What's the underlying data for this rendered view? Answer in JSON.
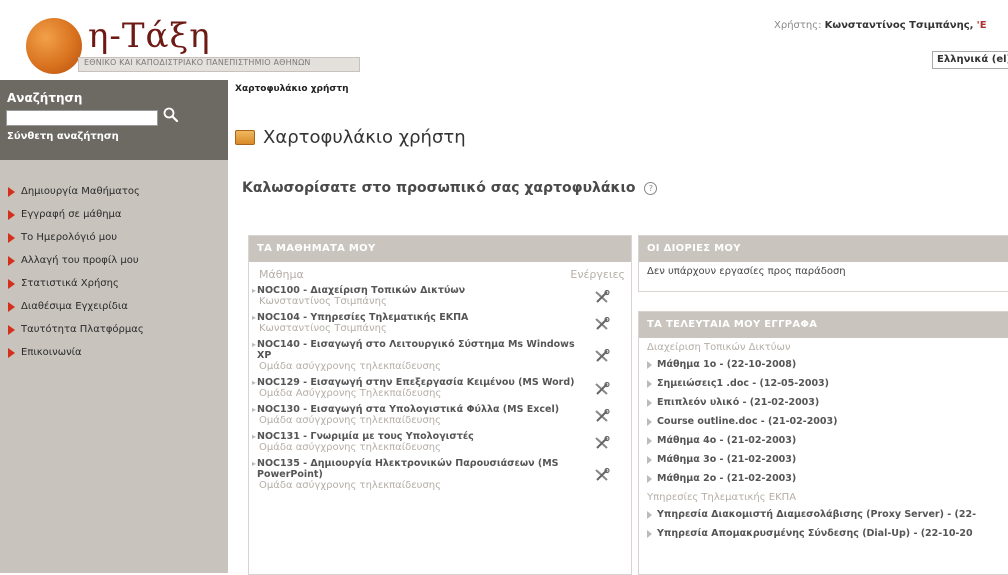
{
  "header": {
    "logo_text": "η-Τάξη",
    "logo_subtitle": "ΕΘΝΙΚΟ ΚΑΙ ΚΑΠΟΔΙΣΤΡΙΑΚΟ ΠΑΝΕΠΙΣΤΗΜΙΟ ΑΘΗΝΩΝ",
    "user_label": "Χρήστης:",
    "user_name": "Κωνσταντίνος Τσιμπάνης,",
    "user_extra": "'Ε",
    "language_selected": "Ελληνικά (el)"
  },
  "sidebar": {
    "search_title": "Αναζήτηση",
    "search_value": "",
    "advanced_search": "Σύνθετη αναζήτηση",
    "menu": [
      {
        "label": "Δημιουργία Μαθήματος"
      },
      {
        "label": "Εγγραφή σε μάθημα"
      },
      {
        "label": "Το Ημερολόγιό μου"
      },
      {
        "label": "Αλλαγή του προφίλ μου"
      },
      {
        "label": "Στατιστικά Χρήσης"
      },
      {
        "label": "Διαθέσιμα Εγχειρίδια"
      },
      {
        "label": "Ταυτότητα Πλατφόρμας"
      },
      {
        "label": "Επικοινωνία"
      }
    ]
  },
  "main": {
    "breadcrumb": "Χαρτοφυλάκιο χρήστη",
    "page_title": "Χαρτοφυλάκιο χρήστη",
    "welcome": "Καλωσορίσατε στο προσωπικό σας χαρτοφυλάκιο",
    "help_glyph": "?"
  },
  "courses": {
    "header": "ΤΑ ΜΑΘΗΜΑΤΑ ΜΟΥ",
    "col_course": "Μάθημα",
    "col_actions": "Ενέργειες",
    "rows": [
      {
        "title": "NOC100 - Διαχείριση Τοπικών Δικτύων",
        "prof": "Κωνσταντίνος Τσιμπάνης"
      },
      {
        "title": "NOC104 - Υπηρεσίες Τηλεματικής ΕΚΠΑ",
        "prof": "Κωνσταντίνος Τσιμπάνης"
      },
      {
        "title": "NOC140 - Εισαγωγή στο Λειτουργικό Σύστημα Ms Windows XP",
        "prof": "Ομάδα ασύγχρονης τηλεκπαίδευσης"
      },
      {
        "title": "NOC129 - Εισαγωγή στην Επεξεργασία Κειμένου (MS Word)",
        "prof": "Ομάδα Ασύγχρονης Τηλεκπαίδευσης"
      },
      {
        "title": "NOC130 - Εισαγωγή στα Υπολογιστικά Φύλλα (MS Excel)",
        "prof": "Ομάδα ασύγχρονης τηλεκπαίδευσης"
      },
      {
        "title": "NOC131 - Γνωριμία με τους Υπολογιστές",
        "prof": "Ομάδα ασύγχρονης τηλεκπαίδευσης"
      },
      {
        "title": "NOC135 - Δημιουργία Ηλεκτρονικών Παρουσιάσεων (MS PowerPoint)",
        "prof": "Ομάδα ασύγχρονης τηλεκπαίδευσης"
      }
    ]
  },
  "deadlines": {
    "header": "ΟΙ ΔΙΟΡΙΕΣ ΜΟΥ",
    "empty_text": "Δεν υπάρχουν εργασίες προς παράδοση"
  },
  "documents": {
    "header": "ΤΑ ΤΕΛΕΥΤΑΙΑ ΜΟΥ ΕΓΓΡΑΦΑ",
    "group1": "Διαχείριση Τοπικών Δικτύων",
    "items1": [
      "Μάθημα 1ο - (22-10-2008)",
      "Σημειώσεις1 .doc - (12-05-2003)",
      "Επιπλεόν υλικό - (21-02-2003)",
      "Course outline.doc - (21-02-2003)",
      "Μάθημα 4ο - (21-02-2003)",
      "Μάθημα 3ο - (21-02-2003)",
      "Μάθημα 2ο - (21-02-2003)"
    ],
    "group2": "Υπηρεσίες Τηλεματικής ΕΚΠΑ",
    "items2": [
      "Υπηρεσία Διακομιστή Διαμεσολάβισης (Proxy Server) - (22-",
      "Υπηρεσία Απομακρυσμένης Σύνδεσης (Dial-Up) - (22-10-20"
    ]
  }
}
